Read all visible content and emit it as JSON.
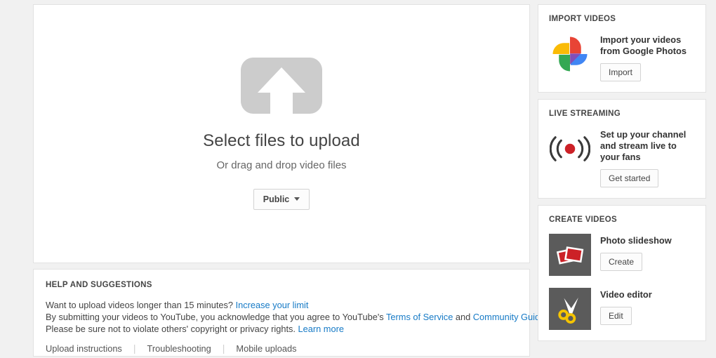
{
  "upload": {
    "icon": "upload-arrow-icon",
    "title": "Select files to upload",
    "subtitle": "Or drag and drop video files",
    "privacy_value": "Public"
  },
  "help": {
    "heading": "HELP AND SUGGESTIONS",
    "line1_text": "Want to upload videos longer than 15 minutes? ",
    "line1_link": "Increase your limit",
    "line2_a": "By submitting your videos to YouTube, you acknowledge that you agree to YouTube's ",
    "line2_link1": "Terms of Service",
    "line2_b": " and ",
    "line2_link2": "Community Guidelines",
    "line2_c": ".",
    "line3_a": "Please be sure not to violate others' copyright or privacy rights. ",
    "line3_link": "Learn more",
    "footer": {
      "upload_instructions": "Upload instructions",
      "troubleshooting": "Troubleshooting",
      "mobile_uploads": "Mobile uploads"
    }
  },
  "sidebar": {
    "import": {
      "heading": "IMPORT VIDEOS",
      "icon": "google-photos-pinwheel-icon",
      "text": "Import your videos from Google Photos",
      "button": "Import"
    },
    "live": {
      "heading": "LIVE STREAMING",
      "icon": "live-broadcast-icon",
      "text": "Set up your channel and stream live to your fans",
      "button": "Get started"
    },
    "create": {
      "heading": "CREATE VIDEOS",
      "items": [
        {
          "icon": "photo-slideshow-icon",
          "text": "Photo slideshow",
          "button": "Create"
        },
        {
          "icon": "scissors-video-editor-icon",
          "text": "Video editor",
          "button": "Edit"
        }
      ]
    }
  },
  "colors": {
    "page_background": "#f1f1f1",
    "card_background": "#ffffff",
    "link_blue": "#167ac6",
    "upload_icon_gray": "#cccccc",
    "thumb_gray": "#5b5b5b",
    "accent_red": "#cc2127",
    "scissors_yellow": "#f5c400"
  }
}
